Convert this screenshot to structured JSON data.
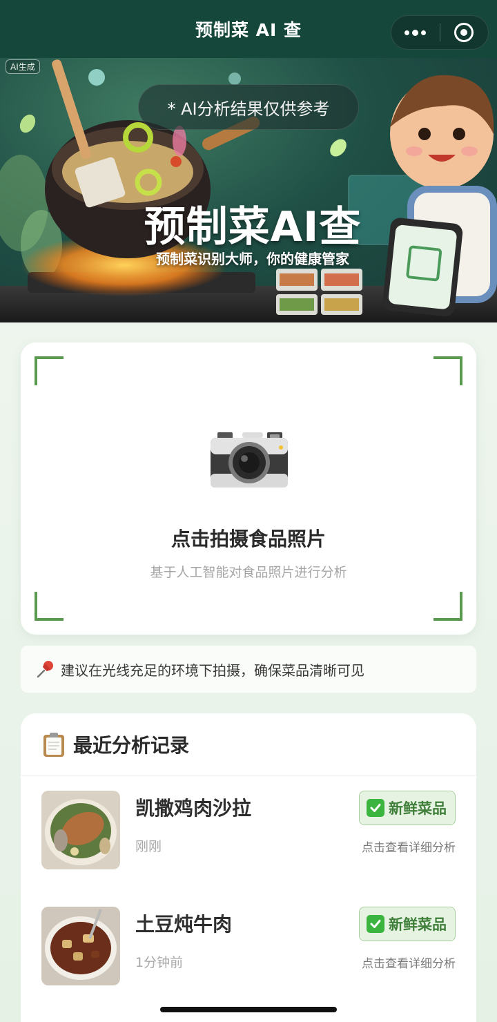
{
  "navbar": {
    "title": "预制菜 AI 查",
    "more_icon": "more-dots-icon",
    "close_icon": "target-icon"
  },
  "banner": {
    "ai_tag": "AI生成",
    "disclaimer": "* AI分析结果仅供参考",
    "title": "预制菜AI查",
    "subtitle": "预制菜识别大师，你的健康管家"
  },
  "scan": {
    "icon": "camera-icon",
    "title": "点击拍摄食品照片",
    "subtitle": "基于人工智能对食品照片进行分析"
  },
  "tip": {
    "icon": "pushpin-icon",
    "text": "建议在光线充足的环境下拍摄，确保菜品清晰可见"
  },
  "history": {
    "icon": "clipboard-icon",
    "title": "最近分析记录",
    "records": [
      {
        "name": "凯撒鸡肉沙拉",
        "time": "刚刚",
        "badge": "新鲜菜品",
        "link": "点击查看详细分析"
      },
      {
        "name": "土豆炖牛肉",
        "time": "1分钟前",
        "badge": "新鲜菜品",
        "link": "点击查看详细分析"
      }
    ]
  },
  "colors": {
    "navbar": "#16473b",
    "accent": "#5a9a4f",
    "badge_bg": "#e6f3e2",
    "badge_text": "#3f7f3a"
  }
}
